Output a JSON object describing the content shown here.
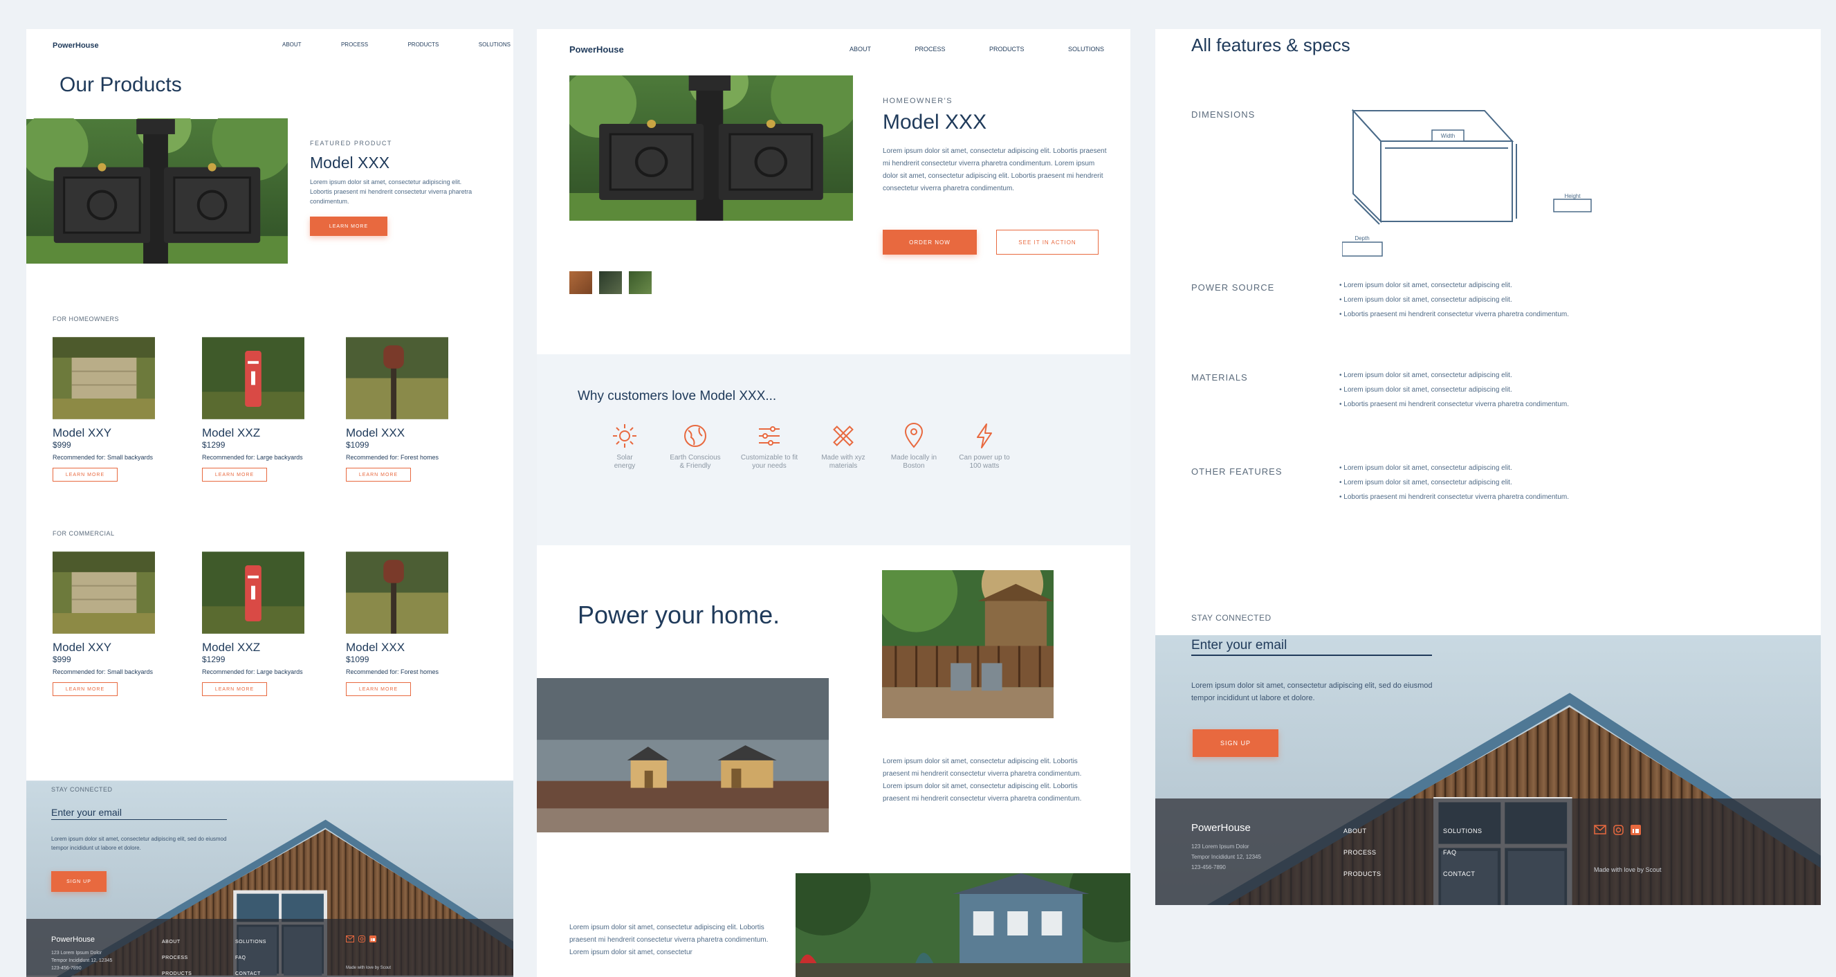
{
  "brand": "PowerHouse",
  "nav": [
    "ABOUT",
    "PROCESS",
    "PRODUCTS",
    "SOLUTIONS"
  ],
  "panel1": {
    "heading": "Our Products",
    "featured_eyebrow": "FEATURED PRODUCT",
    "featured_title": "Model XXX",
    "featured_text": "Lorem ipsum dolor sit amet, consectetur adipiscing elit. Lobortis praesent mi hendrerit consectetur viverra pharetra condimentum.",
    "featured_button": "LEARN MORE",
    "homeowners_label": "FOR HOMEOWNERS",
    "commercial_label": "FOR COMMERCIAL",
    "cards": [
      {
        "title": "Model XXY",
        "price": "$999",
        "rec": "Recommended for: Small backyards",
        "button": "LEARN MORE"
      },
      {
        "title": "Model XXZ",
        "price": "$1299",
        "rec": "Recommended for: Large backyards",
        "button": "LEARN MORE"
      },
      {
        "title": "Model XXX",
        "price": "$1099",
        "rec": "Recommended for: Forest homes",
        "button": "LEARN MORE"
      }
    ],
    "stay_label": "STAY CONNECTED",
    "email_placeholder": "Enter your email",
    "signup_text": "Lorem ipsum dolor sit amet, consectetur adipiscing elit, sed do eiusmod tempor incididunt ut labore et dolore.",
    "signup_button": "SIGN UP",
    "footer_brand": "PowerHouse",
    "footer_address": [
      "123 Lorem Ipsum Dolor",
      "Tempor Incididunt 12, 12345",
      "123-456-7890"
    ],
    "footer_col1": [
      "ABOUT",
      "PROCESS",
      "PRODUCTS"
    ],
    "footer_col2": [
      "SOLUTIONS",
      "FAQ",
      "CONTACT"
    ],
    "footer_credit": "Made with love by Scout"
  },
  "panel2": {
    "eyebrow": "HOMEOWNER'S",
    "title": "Model XXX",
    "description": "Lorem ipsum dolor sit amet, consectetur adipiscing elit. Lobortis praesent mi hendrerit consectetur viverra pharetra condimentum. Lorem ipsum dolor sit amet, consectetur adipiscing elit. Lobortis praesent mi hendrerit consectetur viverra pharetra condimentum.",
    "order_button": "ORDER NOW",
    "action_button": "SEE IT IN ACTION",
    "why_heading": "Why customers love Model XXX...",
    "features": [
      {
        "icon": "sun-icon",
        "label": [
          "Solar",
          "energy"
        ]
      },
      {
        "icon": "globe-icon",
        "label": [
          "Earth Conscious",
          "& Friendly"
        ]
      },
      {
        "icon": "sliders-icon",
        "label": [
          "Customizable to fit",
          "your needs"
        ]
      },
      {
        "icon": "tools-icon",
        "label": [
          "Made with xyz",
          "materials"
        ]
      },
      {
        "icon": "location-pin-icon",
        "label": [
          "Made locally in",
          "Boston"
        ]
      },
      {
        "icon": "lightning-icon",
        "label": [
          "Can power up to",
          "100 watts"
        ]
      }
    ],
    "power_heading": "Power your home.",
    "power_text": "Lorem ipsum dolor sit amet, consectetur adipiscing elit. Lobortis praesent mi hendrerit consectetur viverra pharetra condimentum. Lorem ipsum dolor sit amet, consectetur adipiscing elit. Lobortis praesent mi hendrerit consectetur viverra pharetra condimentum.",
    "bottom_text": "Lorem ipsum dolor sit amet, consectetur adipiscing elit. Lobortis praesent mi hendrerit consectetur viverra pharetra condimentum. Lorem ipsum dolor sit amet, consectetur"
  },
  "panel3": {
    "heading": "All features & specs",
    "dimensions_label": "DIMENSIONS",
    "dim_width": "Width",
    "dim_height": "Height",
    "dim_depth": "Depth",
    "power_label": "POWER SOURCE",
    "materials_label": "MATERIALS",
    "other_label": "OTHER FEATURES",
    "bullets": [
      "Lorem ipsum dolor sit amet, consectetur adipiscing elit.",
      "Lorem ipsum dolor sit amet, consectetur adipiscing elit.",
      "Lobortis praesent mi hendrerit consectetur viverra pharetra condimentum."
    ],
    "stay_label": "STAY CONNECTED",
    "email_placeholder": "Enter your email",
    "signup_text": "Lorem ipsum dolor sit amet, consectetur adipiscing elit, sed do eiusmod tempor incididunt ut labore et dolore.",
    "signup_button": "SIGN UP",
    "footer_brand": "PowerHouse",
    "footer_address": [
      "123 Lorem Ipsum Dolor",
      "Tempor Incididunt 12, 12345",
      "123-456-7890"
    ],
    "footer_col1": [
      "ABOUT",
      "PROCESS",
      "PRODUCTS"
    ],
    "footer_col2": [
      "SOLUTIONS",
      "FAQ",
      "CONTACT"
    ],
    "footer_credit": "Made with love by Scout"
  },
  "colors": {
    "accent": "#e8693f",
    "navy": "#1f3a5a",
    "background": "#eef2f6"
  }
}
